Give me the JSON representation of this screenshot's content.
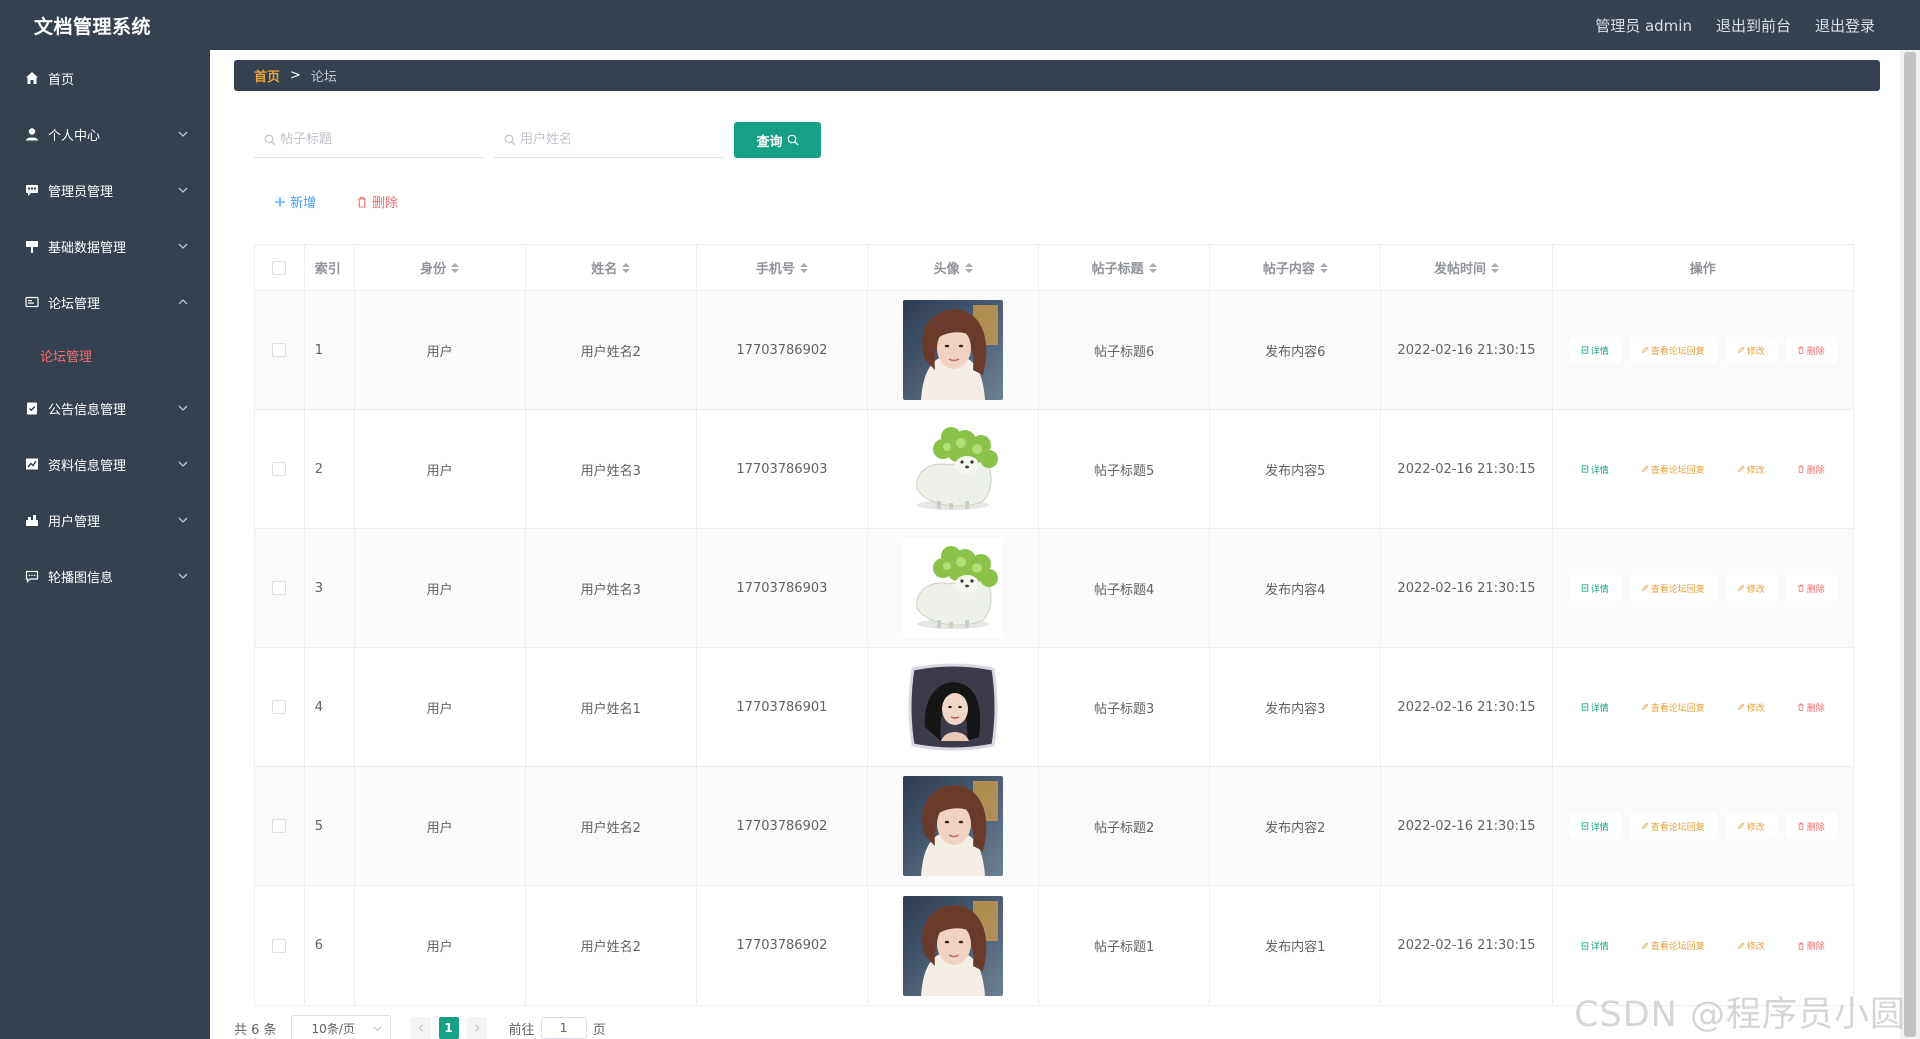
{
  "header": {
    "title": "文档管理系统",
    "links": [
      "管理员 admin",
      "退出到前台",
      "退出登录"
    ]
  },
  "sidebar": {
    "items": [
      {
        "label": "首页",
        "icon": "home-icon",
        "expandable": false
      },
      {
        "label": "个人中心",
        "icon": "user-icon",
        "expandable": true
      },
      {
        "label": "管理员管理",
        "icon": "chat-icon",
        "expandable": true
      },
      {
        "label": "基础数据管理",
        "icon": "sign-icon",
        "expandable": true
      },
      {
        "label": "论坛管理",
        "icon": "forum-icon",
        "expandable": true,
        "open": true,
        "subitems": [
          "论坛管理"
        ]
      },
      {
        "label": "公告信息管理",
        "icon": "notice-icon",
        "expandable": true
      },
      {
        "label": "资料信息管理",
        "icon": "chart-icon",
        "expandable": true
      },
      {
        "label": "用户管理",
        "icon": "group-icon",
        "expandable": true
      },
      {
        "label": "轮播图信息",
        "icon": "message-icon",
        "expandable": true
      }
    ]
  },
  "breadcrumb": {
    "home": "首页",
    "separator": ">",
    "current": "论坛"
  },
  "search": {
    "title_placeholder": "帖子标题",
    "username_placeholder": "用户姓名",
    "query_label": "查询"
  },
  "actions": {
    "add_label": "新增",
    "delete_label": "删除"
  },
  "table": {
    "headers": [
      "索引",
      "身份",
      "姓名",
      "手机号",
      "头像",
      "帖子标题",
      "帖子内容",
      "发帖时间",
      "操作"
    ],
    "rows": [
      {
        "index": "1",
        "role": "用户",
        "name": "用户姓名2",
        "phone": "17703786902",
        "avatar": "woman-photo",
        "title": "帖子标题6",
        "content": "发布内容6",
        "time": "2022-02-16 21:30:15"
      },
      {
        "index": "2",
        "role": "用户",
        "name": "用户姓名3",
        "phone": "17703786903",
        "avatar": "cabbage-dog",
        "title": "帖子标题5",
        "content": "发布内容5",
        "time": "2022-02-16 21:30:15"
      },
      {
        "index": "3",
        "role": "用户",
        "name": "用户姓名3",
        "phone": "17703786903",
        "avatar": "cabbage-dog",
        "title": "帖子标题4",
        "content": "发布内容4",
        "time": "2022-02-16 21:30:15"
      },
      {
        "index": "4",
        "role": "用户",
        "name": "用户姓名1",
        "phone": "17703786901",
        "avatar": "pillow-photo",
        "title": "帖子标题3",
        "content": "发布内容3",
        "time": "2022-02-16 21:30:15"
      },
      {
        "index": "5",
        "role": "用户",
        "name": "用户姓名2",
        "phone": "17703786902",
        "avatar": "woman-photo",
        "title": "帖子标题2",
        "content": "发布内容2",
        "time": "2022-02-16 21:30:15"
      },
      {
        "index": "6",
        "role": "用户",
        "name": "用户姓名2",
        "phone": "17703786902",
        "avatar": "woman-photo",
        "title": "帖子标题1",
        "content": "发布内容1",
        "time": "2022-02-16 21:30:15"
      }
    ],
    "row_actions": {
      "detail": "详情",
      "reply": "查看论坛回复",
      "edit": "修改",
      "delete": "删除"
    }
  },
  "pagination": {
    "total": "共 6 条",
    "page_size": "10条/页",
    "current_page": "1",
    "goto_prefix": "前往",
    "goto_value": "1",
    "goto_suffix": "页"
  },
  "watermark": "CSDN @程序员小圆",
  "colors": {
    "sidebar_bg": "#364150",
    "accent": "#16a085",
    "warning": "#e6a23c",
    "danger": "#f56c6c",
    "primary": "#409eff"
  }
}
